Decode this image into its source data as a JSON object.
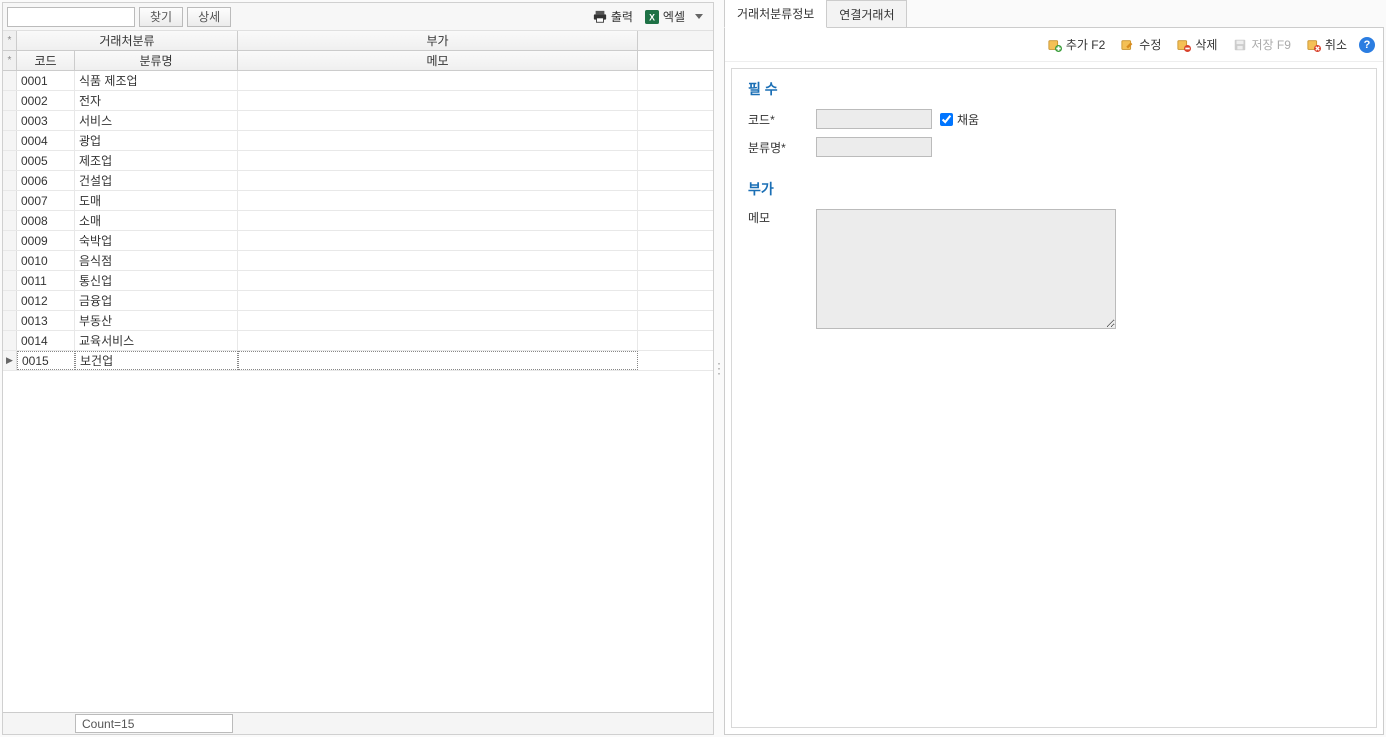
{
  "left": {
    "search_placeholder": "",
    "find_label": "찾기",
    "detail_label": "상세",
    "print_label": "출력",
    "excel_label": "엑셀",
    "header_group_left": "거래처분류",
    "header_group_right": "부가",
    "col_code": "코드",
    "col_name": "분류명",
    "col_memo": "메모",
    "rows": [
      {
        "code": "0001",
        "name": "식품 제조업",
        "memo": ""
      },
      {
        "code": "0002",
        "name": "전자",
        "memo": ""
      },
      {
        "code": "0003",
        "name": "서비스",
        "memo": ""
      },
      {
        "code": "0004",
        "name": "광업",
        "memo": ""
      },
      {
        "code": "0005",
        "name": "제조업",
        "memo": ""
      },
      {
        "code": "0006",
        "name": "건설업",
        "memo": ""
      },
      {
        "code": "0007",
        "name": "도매",
        "memo": ""
      },
      {
        "code": "0008",
        "name": "소매",
        "memo": ""
      },
      {
        "code": "0009",
        "name": "숙박업",
        "memo": ""
      },
      {
        "code": "0010",
        "name": "음식점",
        "memo": ""
      },
      {
        "code": "0011",
        "name": "통신업",
        "memo": ""
      },
      {
        "code": "0012",
        "name": "금융업",
        "memo": ""
      },
      {
        "code": "0013",
        "name": "부동산",
        "memo": ""
      },
      {
        "code": "0014",
        "name": "교육서비스",
        "memo": ""
      },
      {
        "code": "0015",
        "name": "보건업",
        "memo": ""
      }
    ],
    "footer_count": "Count=15",
    "selected_index": 14
  },
  "right": {
    "tab1": "거래처분류정보",
    "tab2": "연결거래처",
    "add_label": "추가 F2",
    "edit_label": "수정",
    "delete_label": "삭제",
    "save_label": "저장 F9",
    "cancel_label": "취소",
    "help_label": "?",
    "section_required": "필 수",
    "field_code": "코드*",
    "field_name": "분류명*",
    "checkbox_fill": "채움",
    "section_additional": "부가",
    "field_memo": "메모"
  }
}
